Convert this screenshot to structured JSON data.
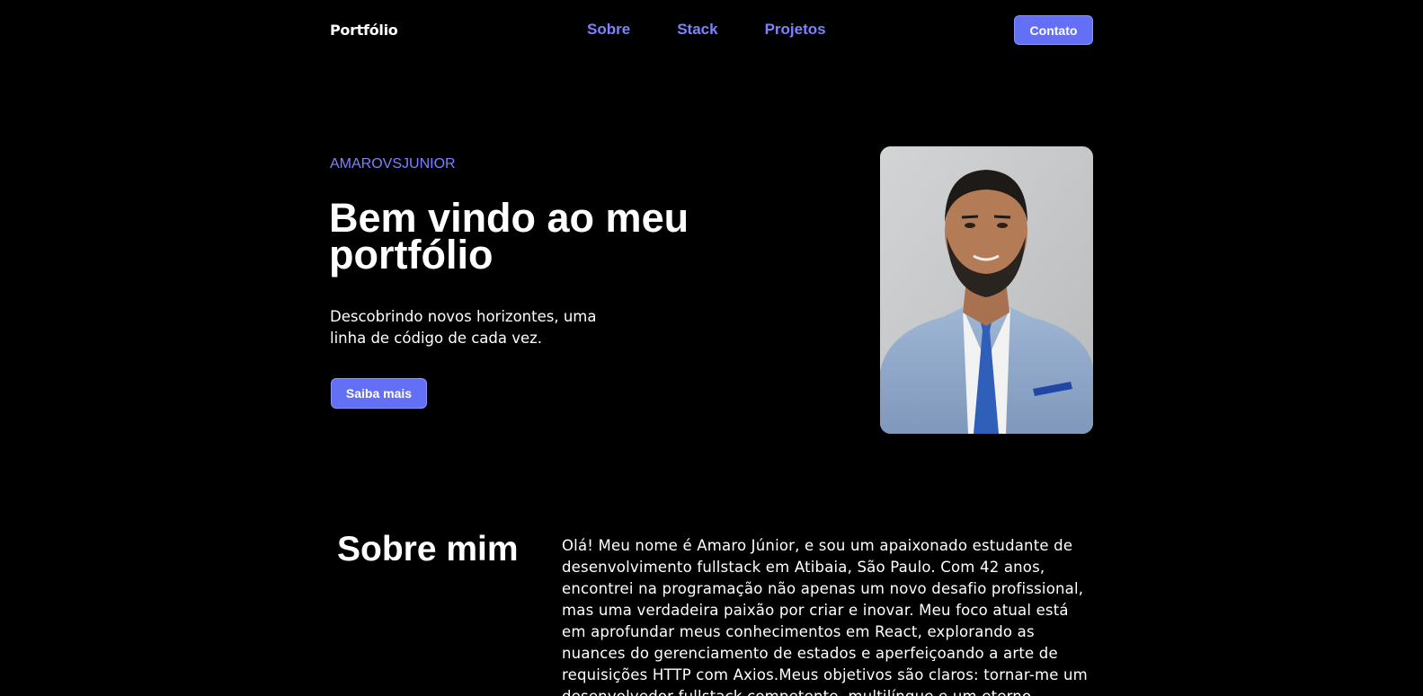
{
  "header": {
    "logo": "Portfólio",
    "nav": [
      "Sobre",
      "Stack",
      "Projetos"
    ],
    "contact_label": "Contato",
    "accent_color": "#6370f5",
    "link_color": "#7b83ff"
  },
  "hero": {
    "tag": "AMAROVSJUNIOR",
    "title": "Bem vindo ao meu portfólio",
    "subtitle": "Descobrindo novos horizontes, uma linha de código de cada vez.",
    "cta_label": "Saiba mais"
  },
  "about": {
    "title": "Sobre mim",
    "text": "Olá! Meu nome é Amaro Júnior, e sou um apaixonado estudante de desenvolvimento fullstack em Atibaia, São Paulo. Com 42 anos, encontrei na programação não apenas um novo desafio profissional, mas uma verdadeira paixão por criar e inovar. Meu foco atual está em aprofundar meus conhecimentos em React, explorando as nuances do gerenciamento de estados e aperfeiçoando a arte de requisições HTTP com Axios.Meus objetivos são claros: tornar-me um desenvolvedor fullstack competente, multilíngue e um eterno aprendiz em um campo"
  }
}
